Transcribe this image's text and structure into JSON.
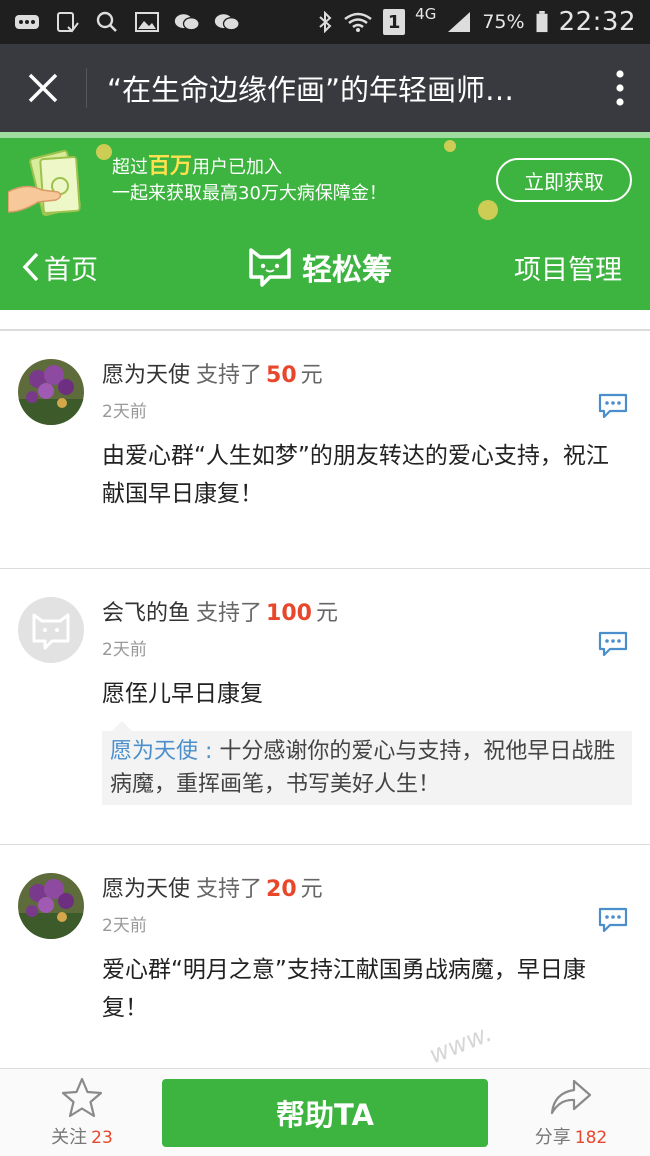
{
  "status_bar": {
    "signal_label": "4G",
    "battery": "75%",
    "time": "22:32",
    "sim_badge": "1",
    "icons": [
      "keyboard-icon",
      "notes-icon",
      "search-icon",
      "gallery-icon",
      "wechat-icon",
      "wechat-icon",
      "bluetooth-icon",
      "wifi-icon",
      "sim-icon",
      "signal-icon",
      "battery-icon"
    ]
  },
  "nav": {
    "title": "“在生命边缘作画”的年轻画师…",
    "close_icon": "close-icon",
    "more_icon": "more-vertical-icon"
  },
  "banner": {
    "line1_prefix": "超过",
    "line1_highlight": "百万",
    "line1_suffix": "用户已加入",
    "line2": "一起来获取最高30万大病保障金！",
    "button": "立即获取",
    "colors": {
      "bg": "#3db340",
      "highlight": "#ffe14d"
    }
  },
  "header": {
    "back_label": "首页",
    "logo_text": "轻松筹",
    "manage_label": "项目管理"
  },
  "comments": [
    {
      "user": "愿为天使",
      "supported": "支持了",
      "amount": "50",
      "unit": "元",
      "time": "2天前",
      "body": "由爱心群“人生如梦”的朋友转达的爱心支持，祝江献国早日康复！",
      "avatar": "flower-photo"
    },
    {
      "user": "会飞的鱼",
      "supported": "支持了",
      "amount": "100",
      "unit": "元",
      "time": "2天前",
      "body": "愿侄儿早日康复",
      "avatar": "default-avatar-icon",
      "reply": {
        "who": "愿为天使 : ",
        "text": "十分感谢你的爱心与支持，祝他早日战胜病魔，重挥画笔，书写美好人生！"
      }
    },
    {
      "user": "愿为天使",
      "supported": "支持了",
      "amount": "20",
      "unit": "元",
      "time": "2天前",
      "body": "爱心群“明月之意”支持江献国勇战病魔，早日康复！",
      "avatar": "flower-photo"
    }
  ],
  "bottom": {
    "follow_label": "关注",
    "follow_count": "23",
    "help_button": "帮助TA",
    "share_label": "分享",
    "share_count": "182"
  },
  "watermark": "www.",
  "colors": {
    "green": "#3db340",
    "amount_red": "#e8472b",
    "reply_blue": "#4a8fcc",
    "nav_dark": "#393a3f"
  }
}
